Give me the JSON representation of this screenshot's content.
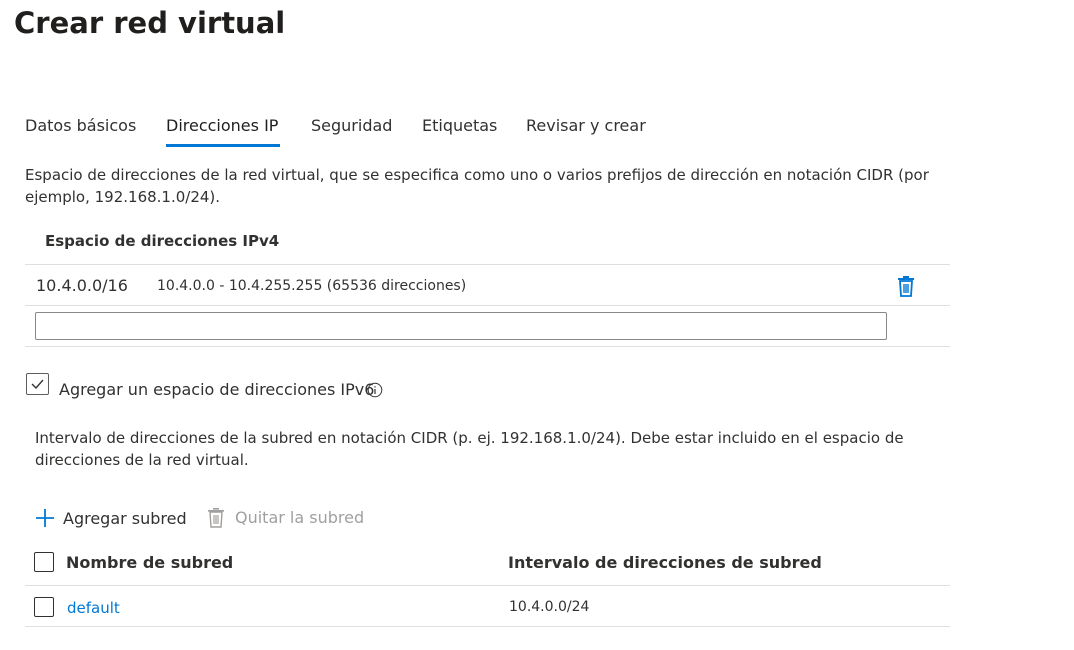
{
  "page": {
    "title": "Crear red virtual"
  },
  "tabs": [
    {
      "label": "Datos básicos"
    },
    {
      "label": "Direcciones IP"
    },
    {
      "label": "Seguridad"
    },
    {
      "label": "Etiquetas"
    },
    {
      "label": "Revisar y crear"
    }
  ],
  "active_tab": "Direcciones IP",
  "ipv4": {
    "description": "Espacio de direcciones de la red virtual, que se especifica como uno o varios prefijos de dirección en notación CIDR (por ejemplo, 192.168.1.0/24).",
    "column_header": "Espacio de direcciones IPv4",
    "rows": [
      {
        "cidr": "10.4.0.0/16",
        "range": "10.4.0.0 - 10.4.255.255 (65536 direcciones)",
        "icon": "delete-icon"
      }
    ],
    "new_address_value": "",
    "new_address_placeholder": ""
  },
  "ipv6": {
    "label": "Agregar un espacio de direcciones IPv6",
    "checked": true,
    "info_icon": "info-icon"
  },
  "subnets": {
    "description": "Intervalo de direcciones de la subred en notación CIDR (p. ej. 192.168.1.0/24). Debe estar incluido en el espacio de direcciones de la red virtual.",
    "add_label": "Agregar subred",
    "remove_label": "Quitar la subred",
    "columns": [
      "Nombre de subred",
      "Intervalo de direcciones de subred"
    ],
    "rows": [
      {
        "name": "default",
        "range": "10.4.0.0/24"
      }
    ]
  },
  "colors": {
    "accent": "#0078d4",
    "text": "#323130",
    "disabled": "#a19f9d",
    "divider": "#e1dfdd"
  }
}
